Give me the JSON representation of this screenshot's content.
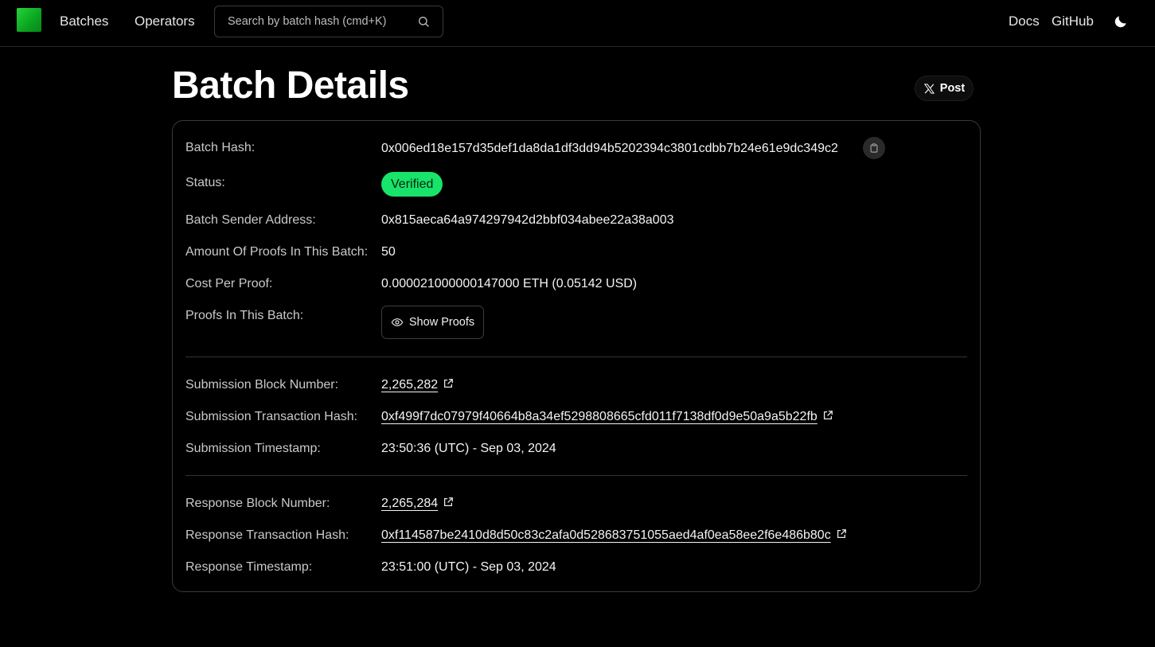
{
  "nav": {
    "batches_label": "Batches",
    "operators_label": "Operators",
    "search_placeholder": "Search by batch hash (cmd+K)",
    "docs_label": "Docs",
    "github_label": "GitHub"
  },
  "header": {
    "title": "Batch Details",
    "post_label": "Post"
  },
  "details": {
    "batch_hash_label": "Batch Hash:",
    "batch_hash": "0x006ed18e157d35def1da8da1df3dd94b5202394c3801cdbb7b24e61e9dc349c2",
    "status_label": "Status:",
    "status": "Verified",
    "sender_label": "Batch Sender Address:",
    "sender": "0x815aeca64a974297942d2bbf034abee22a38a003",
    "amount_label": "Amount Of Proofs In This Batch:",
    "amount": "50",
    "cost_label": "Cost Per Proof:",
    "cost": "0.000021000000147000 ETH (0.05142 USD)",
    "proofs_label": "Proofs In This Batch:",
    "show_proofs_label": "Show Proofs"
  },
  "submission": {
    "block_label": "Submission Block Number:",
    "block": "2,265,282",
    "tx_label": "Submission Transaction Hash:",
    "tx": "0xf499f7dc07979f40664b8a34ef5298808665cfd011f7138df0d9e50a9a5b22fb",
    "timestamp_label": "Submission Timestamp:",
    "timestamp": "23:50:36 (UTC) - Sep 03, 2024"
  },
  "response": {
    "block_label": "Response Block Number:",
    "block": "2,265,284",
    "tx_label": "Response Transaction Hash:",
    "tx": "0xf114587be2410d8d50c83c2afa0d528683751055aed4af0ea58ee2f6e486b80c",
    "timestamp_label": "Response Timestamp:",
    "timestamp": "23:51:00 (UTC) - Sep 03, 2024"
  },
  "colors": {
    "background": "#000000",
    "status_verified": "#18e36a",
    "logo": "#16c22e"
  }
}
